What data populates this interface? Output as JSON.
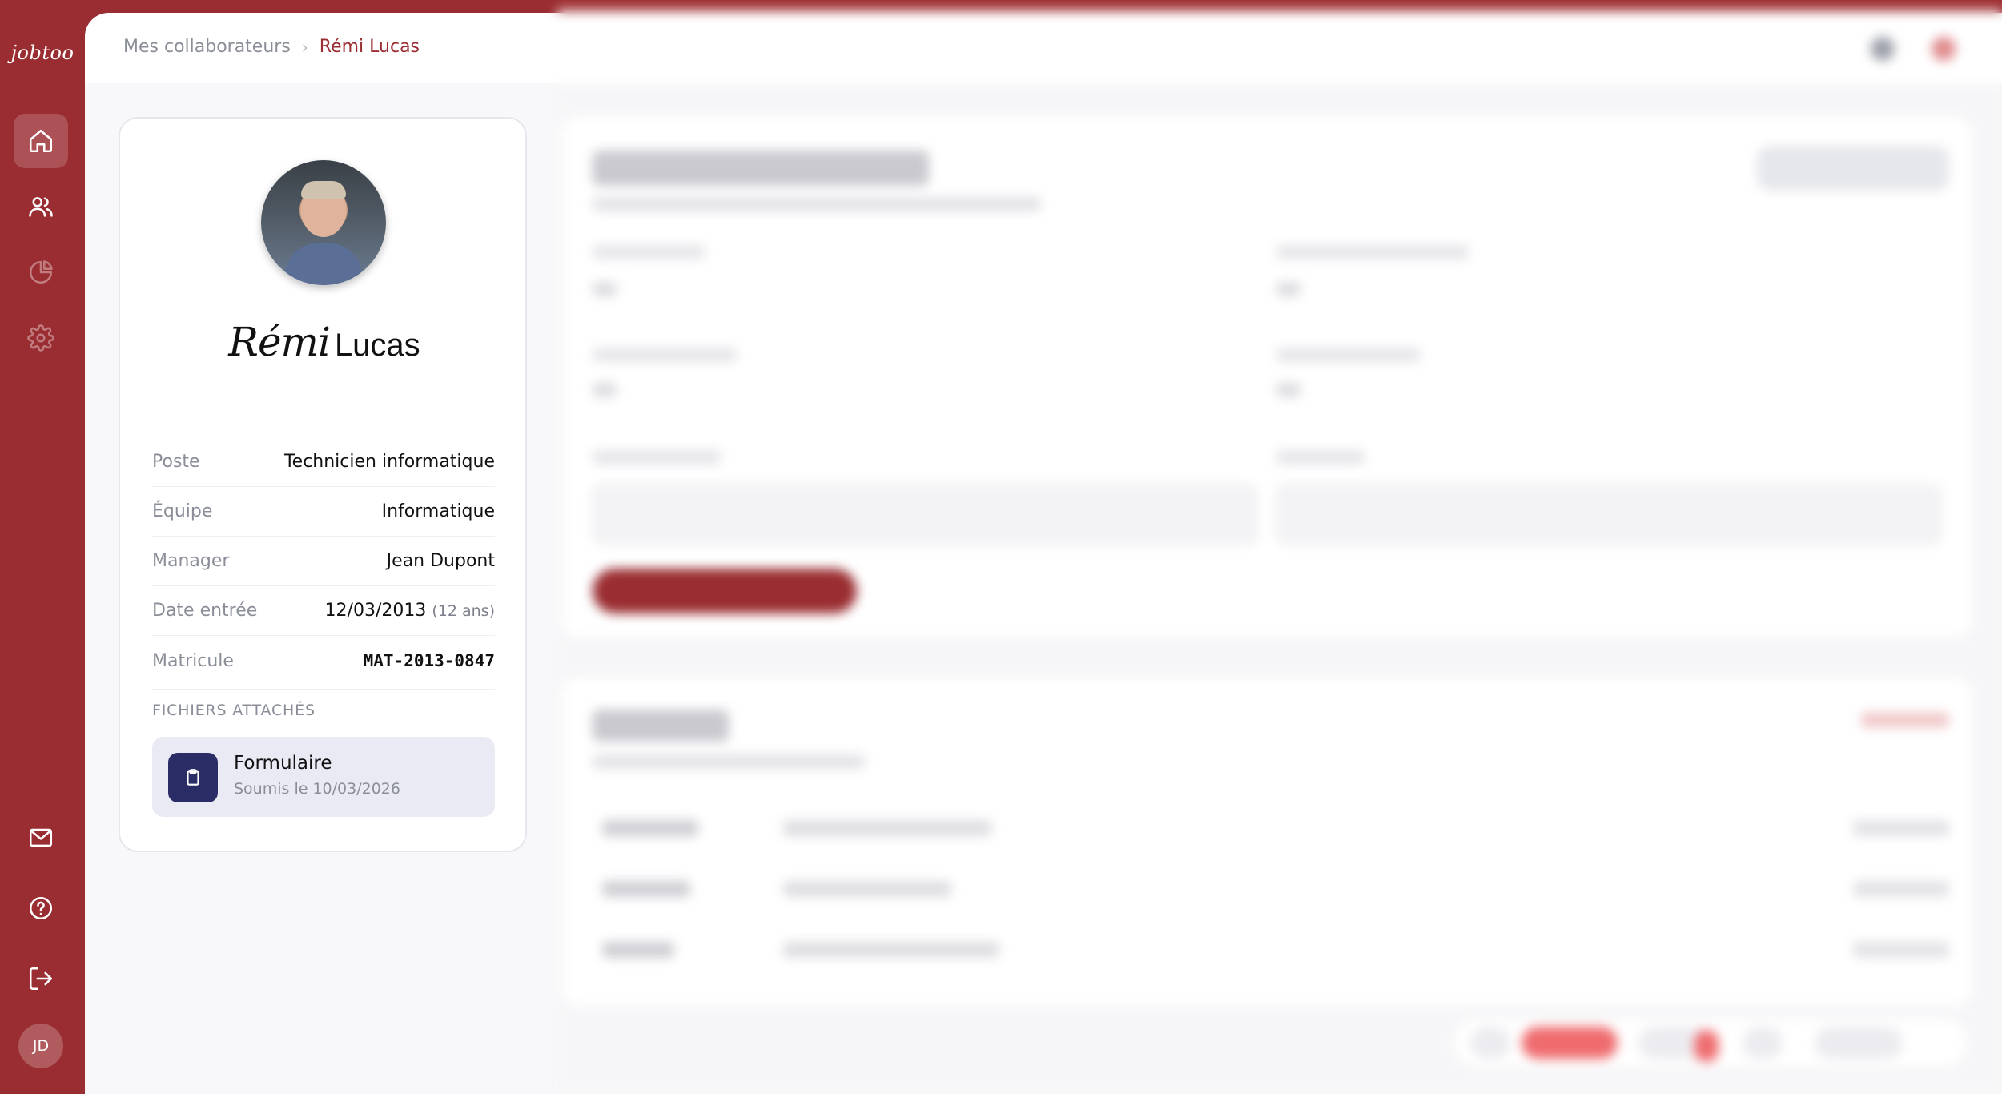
{
  "app": {
    "logo_text": "jobtoo",
    "user_initials": "JD"
  },
  "sidebar": {
    "items": [
      {
        "name": "home",
        "icon": "home-icon",
        "active": true
      },
      {
        "name": "collaborateurs",
        "icon": "users-icon",
        "active": false
      },
      {
        "name": "statistiques",
        "icon": "pie-chart-icon",
        "active": false
      },
      {
        "name": "parametres",
        "icon": "gear-icon",
        "active": false
      }
    ],
    "bottom_items": [
      {
        "name": "messages",
        "icon": "mail-icon"
      },
      {
        "name": "aide",
        "icon": "help-icon"
      },
      {
        "name": "deconnexion",
        "icon": "logout-icon"
      }
    ]
  },
  "breadcrumb": {
    "parent": "Mes collaborateurs",
    "separator": "›",
    "current": "Rémi Lucas"
  },
  "profile": {
    "first_name": "Rémi",
    "last_name": "Lucas",
    "fields": [
      {
        "label": "Poste",
        "value": "Technicien informatique"
      },
      {
        "label": "Équipe",
        "value": "Informatique"
      },
      {
        "label": "Manager",
        "value": "Jean Dupont"
      },
      {
        "label": "Date entrée",
        "value": "12/03/2013",
        "extra": "(12 ans)"
      },
      {
        "label": "Matricule",
        "value": "MAT-2013-0847"
      }
    ],
    "files_title": "FICHIERS ATTACHÉS",
    "files": [
      {
        "name": "Formulaire",
        "date": "Soumis le 10/03/2026",
        "icon": "clipboard-icon"
      }
    ]
  },
  "colors": {
    "brand": "#9a2d31",
    "file_icon_bg": "#2a2c66",
    "file_item_bg": "#eaeaf5"
  }
}
